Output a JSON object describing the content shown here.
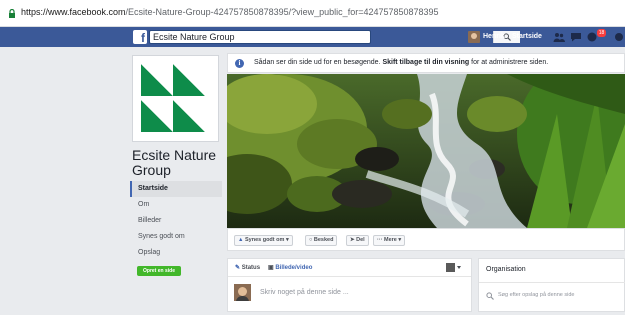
{
  "browser": {
    "url_host": "https://www.facebook.com",
    "url_rest": "/Ecsite-Nature-Group-424757850878395/?view_public_for=424757850878395"
  },
  "header": {
    "logo": "f",
    "search_value": "Ecsite Nature Group",
    "user_name": "Henrik",
    "home_label": "Startside",
    "notification_count": "18"
  },
  "info_banner": {
    "lead": "Sådan ser din side ud for en besøgende.",
    "link": "Skift tilbage til din visning",
    "trail": "for at administrere siden."
  },
  "sidebar": {
    "page_name": "Ecsite Nature Group",
    "nav": [
      {
        "label": "Startside",
        "active": true
      },
      {
        "label": "Om",
        "active": false
      },
      {
        "label": "Billeder",
        "active": false
      },
      {
        "label": "Synes godt om",
        "active": false
      },
      {
        "label": "Opslag",
        "active": false
      }
    ],
    "create_page": "Opret en side"
  },
  "actions": {
    "like": "Synes godt om",
    "message": "Besked",
    "share": "Del",
    "more": "Mere"
  },
  "composer": {
    "status_tab": "Status",
    "photo_tab": "Billede/video",
    "placeholder": "Skriv noget på denne side ..."
  },
  "right_column": {
    "org_title": "Organisation",
    "search_placeholder": "Søg efter opslag på denne side"
  },
  "colors": {
    "fb_blue": "#3b5998",
    "logo_green": "#0e8c4a",
    "create_green": "#42b72a"
  }
}
